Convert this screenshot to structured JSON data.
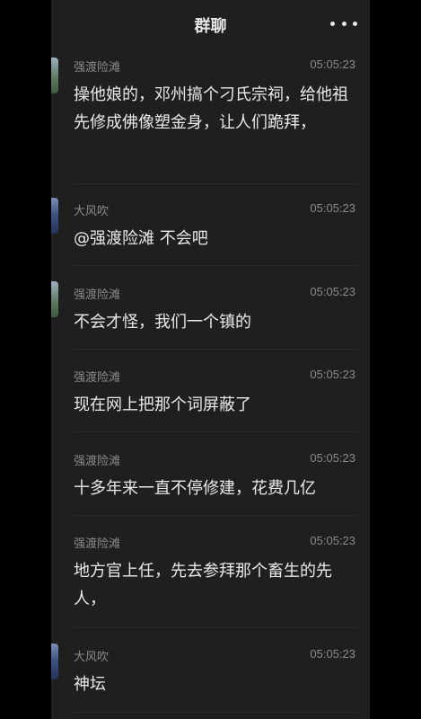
{
  "header": {
    "title": "群聊",
    "more_icon": "more-horizontal-icon"
  },
  "messages": [
    {
      "sender": "强渡险滩",
      "time": "05:05:23",
      "text": "操他娘的，邓州搞个刁氏宗祠，给他祖先修成佛像塑金身，让人们跪拜，",
      "avatar": "avatar-landscape"
    },
    {
      "sender": "大风吹",
      "time": "05:05:23",
      "text": "@强渡险滩 不会吧",
      "avatar": "avatar-blue"
    },
    {
      "sender": "强渡险滩",
      "time": "05:05:23",
      "text": "不会才怪，我们一个镇的",
      "avatar": "avatar-landscape"
    },
    {
      "sender": "强渡险滩",
      "time": "05:05:23",
      "text": "现在网上把那个词屏蔽了"
    },
    {
      "sender": "强渡险滩",
      "time": "05:05:23",
      "text": "十多年来一直不停修建，花费几亿"
    },
    {
      "sender": "强渡险滩",
      "time": "05:05:23",
      "text": "地方官上任，先去参拜那个畜生的先人，"
    },
    {
      "sender": "大风吹",
      "time": "05:05:23",
      "text": "神坛",
      "avatar": "avatar-blue"
    }
  ],
  "colors": {
    "background": "#1f1f1f",
    "text": "#e9e9e9",
    "meta": "#8a8a8a"
  }
}
